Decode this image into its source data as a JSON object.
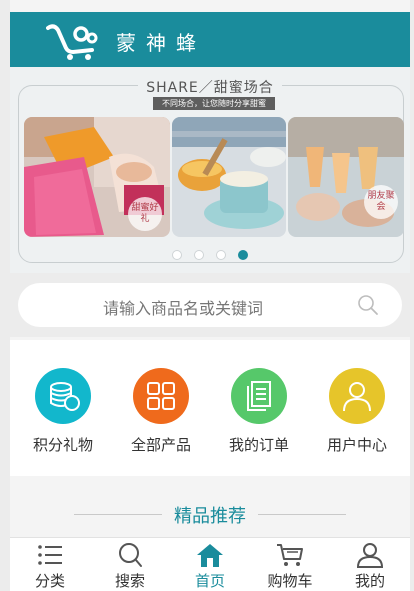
{
  "header": {
    "title": "蒙神蜂",
    "logo_icon": "shopping-cart-logo-icon"
  },
  "banner": {
    "headline": "SHARE／甜蜜场合",
    "subline": "不同场合，让您随时分享甜蜜",
    "stamps": [
      {
        "text": "甜蜜好礼"
      },
      {
        "text": "朋友聚会"
      }
    ],
    "dots_count": 4,
    "active_dot": 4
  },
  "search": {
    "placeholder": "请输入商品名或关键词",
    "icon": "search-icon"
  },
  "categories": [
    {
      "label": "积分礼物",
      "icon": "coins-icon",
      "color": "#12b7cc"
    },
    {
      "label": "全部产品",
      "icon": "grid-icon",
      "color": "#ef6a1c"
    },
    {
      "label": "我的订单",
      "icon": "document-icon",
      "color": "#56c86a"
    },
    {
      "label": "用户中心",
      "icon": "user-icon",
      "color": "#e6c52a"
    }
  ],
  "featured": {
    "title": "精品推荐"
  },
  "tabbar": {
    "items": [
      {
        "label": "分类",
        "icon": "list-icon"
      },
      {
        "label": "搜索",
        "icon": "search-icon"
      },
      {
        "label": "首页",
        "icon": "home-icon",
        "active": true
      },
      {
        "label": "购物车",
        "icon": "cart-icon"
      },
      {
        "label": "我的",
        "icon": "user-icon"
      }
    ]
  },
  "colors": {
    "brand": "#1a8c9c",
    "active_tab": "#1a8c9c"
  }
}
